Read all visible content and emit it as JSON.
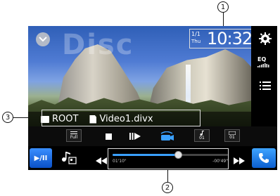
{
  "callouts": {
    "c1": "1",
    "c2": "2",
    "c3": "3"
  },
  "video": {
    "watermark": "Disc"
  },
  "clock": {
    "date": "1/1",
    "day": "Thu",
    "time": "10:32"
  },
  "right_panel": {
    "eq_label": "EQ"
  },
  "filepath": {
    "folder": "ROOT",
    "file": "Video1.divx"
  },
  "controls": {
    "repeat_label": "Full",
    "audio_label": "01",
    "subtitle_label": "01"
  },
  "bottom": {
    "play_label": "▶/II"
  },
  "seek": {
    "elapsed": "01'10\"",
    "remaining": "-00'49\"",
    "progress": 0.57
  },
  "colors": {
    "accent": "#0a50c8",
    "screen_bg": "#000000"
  }
}
